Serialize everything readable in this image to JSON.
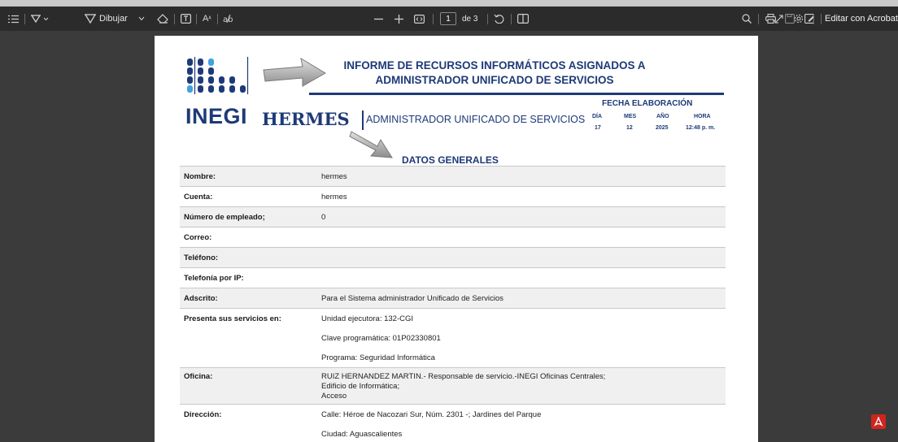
{
  "toolbar": {
    "draw_label": "Dibujar",
    "page_current": "1",
    "page_total": "de 3",
    "acrobat_label": "Editar con Acrobat"
  },
  "doc": {
    "title_line1": "INFORME DE RECURSOS INFORMÁTICOS ASIGNADOS A",
    "title_line2": "ADMINISTRADOR UNIFICADO DE SERVICIOS",
    "logo_text": "INEGI",
    "system_name": "HERMES",
    "system_subtitle": "ADMINISTRADOR UNIFICADO DE SERVICIOS",
    "fecha": {
      "title": "FECHA ELABORACIÓN",
      "headers": [
        "DÍA",
        "MES",
        "AÑO",
        "HORA"
      ],
      "values": [
        "17",
        "12",
        "2025",
        "12:48 p. m."
      ]
    },
    "section": "DATOS GENERALES",
    "rows": [
      {
        "label": "Nombre:",
        "values": [
          "hermes"
        ]
      },
      {
        "label": "Cuenta:",
        "values": [
          "hermes"
        ]
      },
      {
        "label": "Número de empleado;",
        "values": [
          "0"
        ]
      },
      {
        "label": "Correo:",
        "values": [
          ""
        ]
      },
      {
        "label": "Teléfono:",
        "values": [
          ""
        ]
      },
      {
        "label": "Telefonía por IP:",
        "values": [
          ""
        ]
      },
      {
        "label": "Adscrito:",
        "values": [
          "Para el Sistema administrador Unificado de Servicios"
        ]
      },
      {
        "label": "Presenta sus servicios en:",
        "values": [
          "Unidad ejecutora: 132-CGI",
          "Clave programática: 01P02330801",
          "Programa: Seguridad Informática"
        ]
      },
      {
        "label": "Oficina:",
        "values": [
          "RUIZ HERNANDEZ MARTIN.- Responsable de servicio.-INEGI Oficinas Centrales;",
          "Edificio de Informática;",
          "Acceso"
        ]
      },
      {
        "label": "Dirección:",
        "values": [
          "Calle: Héroe de Nacozari Sur, Núm. 2301 -;  Jardines del Parque",
          "Ciudad: Aguascalientes"
        ]
      }
    ]
  },
  "colors": {
    "brand": "#1d3a78",
    "toolbar_bg": "#2b2b2b",
    "viewer_bg": "#3b3b3b",
    "pdf_red": "#d0251c"
  }
}
